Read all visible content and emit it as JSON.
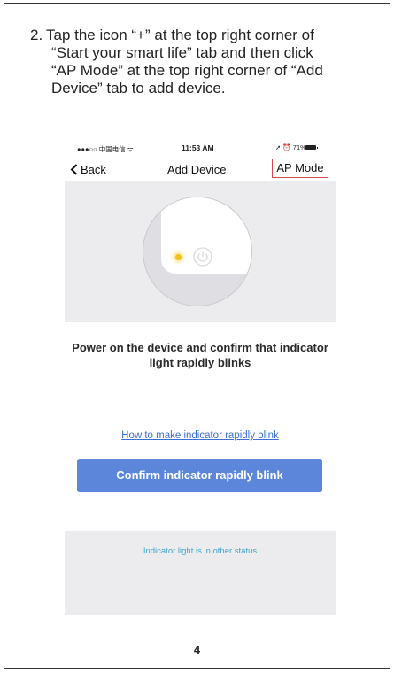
{
  "instruction": {
    "number": "2.",
    "lines": [
      "Tap the icon “+” at the top right corner of",
      "“Start your smart life” tab and then click",
      "“AP Mode” at the top right corner of “Add",
      "Device” tab to add device."
    ]
  },
  "phone": {
    "status": {
      "carrier": "●●●○○ 中国电信 ᯤ",
      "time": "11:53 AM",
      "right": "➚ ⏰ 71%"
    },
    "nav": {
      "back": "Back",
      "title": "Add Device",
      "ap_mode": "AP Mode"
    },
    "main": {
      "message": "Power on the device and confirm that indicator light rapidly blinks",
      "howto_link": "How to make indicator rapidly blink",
      "confirm_button": "Confirm indicator rapidly blink"
    },
    "footer": {
      "other_status": "Indicator light is in other status"
    }
  },
  "page_number": "4",
  "colors": {
    "accent_button": "#5b86d9",
    "link": "#3b6fd6",
    "highlight_box": "#d84a4a",
    "led": "#f2c21c"
  }
}
